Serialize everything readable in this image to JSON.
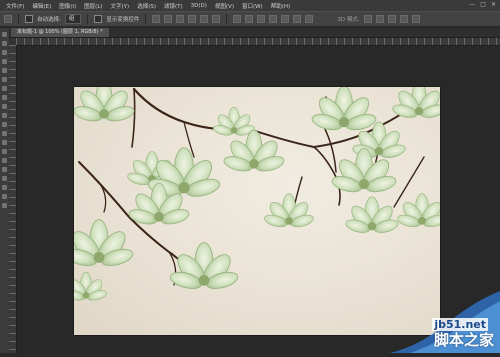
{
  "menu": [
    "文件(F)",
    "编辑(E)",
    "图像(I)",
    "图层(L)",
    "文字(Y)",
    "选择(S)",
    "滤镜(T)",
    "3D(D)",
    "视图(V)",
    "窗口(W)",
    "帮助(H)"
  ],
  "window_controls": {
    "minimize": "—",
    "maximize": "□",
    "close": "✕"
  },
  "options": {
    "auto_select_label": "自动选择:",
    "auto_select_value": "组",
    "show_transform_label": "显示变换控件",
    "mode_3d_label": "3D 模式:"
  },
  "document_tab": "未标题-1 @ 100% (图层 1, RGB/8) *",
  "watermark": {
    "site": "jb51.net",
    "text": "脚本之家"
  },
  "colors": {
    "ui_bg": "#282828",
    "menubar": "#3a3a3a",
    "optbar": "#434343",
    "artwork_bg": "#ebe5d8",
    "petal": "#c9dcb8",
    "branch": "#3b2418"
  }
}
